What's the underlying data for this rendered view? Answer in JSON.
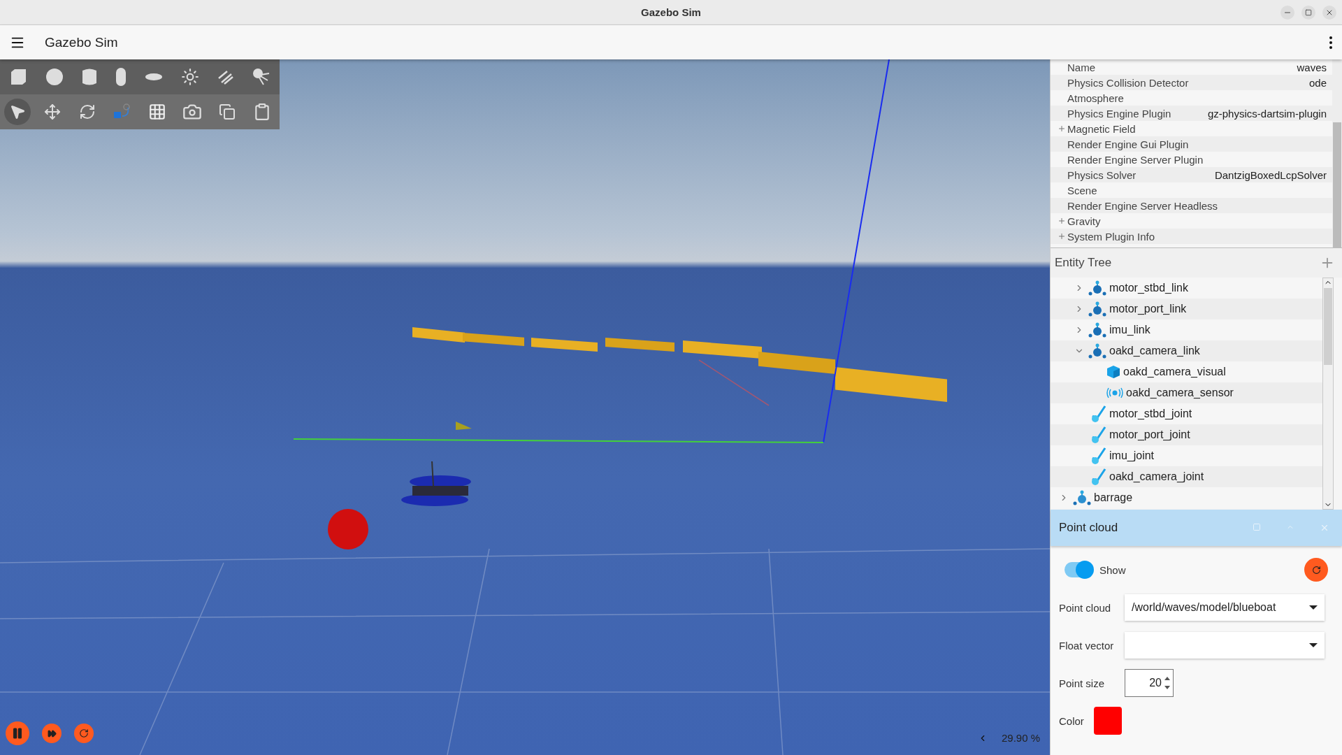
{
  "window": {
    "title": "Gazebo Sim"
  },
  "app_bar": {
    "title": "Gazebo Sim"
  },
  "toolbar": {
    "shapes": [
      {
        "kind": "box"
      },
      {
        "kind": "sphere"
      },
      {
        "kind": "cylinder"
      },
      {
        "kind": "capsule"
      },
      {
        "kind": "ellipsoid"
      },
      {
        "kind": "sun"
      },
      {
        "kind": "directional"
      },
      {
        "kind": "spot"
      }
    ],
    "tools": [
      {
        "kind": "select",
        "selected": true
      },
      {
        "kind": "translate",
        "selected": false
      },
      {
        "kind": "rotate",
        "selected": false
      },
      {
        "kind": "transform",
        "selected": false
      },
      {
        "kind": "grid",
        "selected": false
      },
      {
        "kind": "camera",
        "selected": false
      },
      {
        "kind": "copy",
        "selected": false
      },
      {
        "kind": "paste",
        "selected": false
      }
    ]
  },
  "world_properties": [
    {
      "label": "Name",
      "value": "waves",
      "expandable": false
    },
    {
      "label": "Physics Collision Detector",
      "value": "ode",
      "expandable": false
    },
    {
      "label": "Atmosphere",
      "expandable": false
    },
    {
      "label": "Physics Engine Plugin",
      "value": "gz-physics-dartsim-plugin",
      "expandable": false
    },
    {
      "label": "Magnetic Field",
      "expandable": true
    },
    {
      "label": "Render Engine Gui Plugin",
      "expandable": false
    },
    {
      "label": "Render Engine Server Plugin",
      "expandable": false
    },
    {
      "label": "Physics Solver",
      "value": "DantzigBoxedLcpSolver",
      "expandable": false
    },
    {
      "label": "Scene",
      "expandable": false
    },
    {
      "label": "Render Engine Server Headless",
      "expandable": false
    },
    {
      "label": "Gravity",
      "expandable": true
    },
    {
      "label": "System Plugin Info",
      "expandable": true
    }
  ],
  "entity_tree": {
    "title": "Entity Tree",
    "items": [
      {
        "children": [
          {
            "name": "motor_stbd_link",
            "kind": "link",
            "expanded": false
          },
          {
            "name": "motor_port_link",
            "kind": "link",
            "expanded": false
          },
          {
            "name": "imu_link",
            "kind": "link",
            "expanded": false
          },
          {
            "name": "oakd_camera_link",
            "kind": "link",
            "expanded": true,
            "children": [
              {
                "name": "oakd_camera_visual",
                "kind": "visual"
              },
              {
                "name": "oakd_camera_sensor",
                "kind": "sensor"
              }
            ]
          },
          {
            "name": "motor_stbd_joint",
            "kind": "joint"
          },
          {
            "name": "motor_port_joint",
            "kind": "joint"
          },
          {
            "name": "imu_joint",
            "kind": "joint"
          },
          {
            "name": "oakd_camera_joint",
            "kind": "joint"
          }
        ]
      },
      {
        "name": "barrage",
        "kind": "model",
        "expanded": false
      }
    ]
  },
  "point_cloud": {
    "title": "Point cloud",
    "show": {
      "label": "Show",
      "on": true
    },
    "point_cloud_field": {
      "label": "Point cloud",
      "value": "/world/waves/model/blueboat"
    },
    "float_vector_field": {
      "label": "Float vector"
    },
    "point_size": {
      "label": "Point size",
      "value": "20"
    },
    "color": {
      "label": "Color",
      "color": "#ff0000"
    }
  },
  "real_time_factor": "29.90 %"
}
